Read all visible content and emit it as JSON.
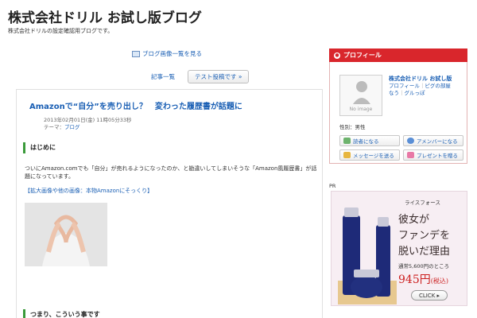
{
  "header": {
    "title": "株式会社ドリル お試し版ブログ",
    "description": "株式会社ドリルの設定確認用ブログです。"
  },
  "nav": {
    "image_list_link": "ブログ画像一覧を見る",
    "article_list_label": "記事一覧",
    "current_article_button": "テスト投稿です »"
  },
  "article": {
    "title": "Amazonで“自分”を売り出し？　変わった履歴書が話題に",
    "date": "2013年02月01日(金) 11時05分33秒",
    "theme_label": "テーマ：",
    "theme_value": "ブログ",
    "section1_heading": "はじめに",
    "body": "ついにAmazon.comでも「自分」が売れるようになったのか、と勘違いしてしまいそうな「Amazon風履歴書」が話題になっています。",
    "image_link": "【拡大画像や他の画像：本物Amazonにそっくり】",
    "section2_heading": "つまり、こういう事です"
  },
  "sidebar": {
    "profile_header": "プロフィール",
    "profile_image_text": "No image",
    "name": "株式会社ドリル お試し版",
    "links": [
      "プロフィール",
      "ピグの部屋",
      "なう",
      "グルっぽ"
    ],
    "link_separator": "｜",
    "gender": "性別：男性",
    "buttons": {
      "reader": "読者になる",
      "ameba_member": "アメンバーになる",
      "message": "メッセージを送る",
      "present": "プレゼントを贈る"
    }
  },
  "ad": {
    "label": "PR",
    "brand": "ライスフォース",
    "line1": "彼女が",
    "line2": "ファンデを",
    "line3": "脱いだ理由",
    "normal_price_text": "通常5,600円のところ",
    "price": "945円",
    "tax": "(税込)",
    "click_label": "CLICK ▸"
  },
  "colors": {
    "accent_red": "#d9262c",
    "link_blue": "#1a5fb4",
    "heading_green": "#3a9a3a"
  }
}
